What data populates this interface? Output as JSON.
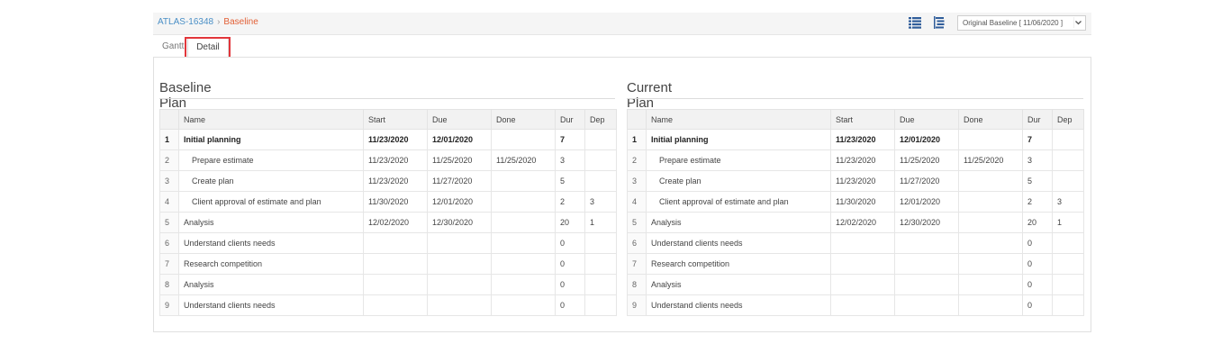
{
  "breadcrumb": {
    "project": "ATLAS-16348",
    "separator": "›",
    "current": "Baseline"
  },
  "baseline_select": {
    "value": "Original Baseline [ 11/06/2020 ]"
  },
  "tabs": [
    {
      "label": "Gantt"
    },
    {
      "label": "Detail",
      "active": true
    }
  ],
  "columns": {
    "name": "Name",
    "start": "Start",
    "due": "Due",
    "done": "Done",
    "dur": "Dur",
    "dep": "Dep"
  },
  "baseline": {
    "title": "Baseline Plan",
    "rows": [
      {
        "num": "1",
        "name": "Initial planning",
        "start": "11/23/2020",
        "due": "12/01/2020",
        "done": "",
        "dur": "7",
        "dep": "",
        "bold": true,
        "indent": 0
      },
      {
        "num": "2",
        "name": "Prepare estimate",
        "start": "11/23/2020",
        "due": "11/25/2020",
        "done": "11/25/2020",
        "dur": "3",
        "dep": "",
        "indent": 1
      },
      {
        "num": "3",
        "name": "Create plan",
        "start": "11/23/2020",
        "due": "11/27/2020",
        "done": "",
        "dur": "5",
        "dep": "",
        "indent": 1
      },
      {
        "num": "4",
        "name": "Client approval of estimate and plan",
        "start": "11/30/2020",
        "due": "12/01/2020",
        "done": "",
        "dur": "2",
        "dep": "3",
        "indent": 1
      },
      {
        "num": "5",
        "name": "Analysis",
        "start": "12/02/2020",
        "due": "12/30/2020",
        "done": "",
        "dur": "20",
        "dep": "1",
        "indent": 0
      },
      {
        "num": "6",
        "name": "Understand clients needs",
        "start": "",
        "due": "",
        "done": "",
        "dur": "0",
        "dep": "",
        "indent": 0
      },
      {
        "num": "7",
        "name": "Research competition",
        "start": "",
        "due": "",
        "done": "",
        "dur": "0",
        "dep": "",
        "indent": 0
      },
      {
        "num": "8",
        "name": "Analysis",
        "start": "",
        "due": "",
        "done": "",
        "dur": "0",
        "dep": "",
        "indent": 0
      },
      {
        "num": "9",
        "name": "Understand clients needs",
        "start": "",
        "due": "",
        "done": "",
        "dur": "0",
        "dep": "",
        "indent": 0
      }
    ]
  },
  "current": {
    "title": "Current Plan",
    "rows": [
      {
        "num": "1",
        "name": "Initial planning",
        "start": "11/23/2020",
        "due": "12/01/2020",
        "done": "",
        "dur": "7",
        "dep": "",
        "bold": true,
        "indent": 0
      },
      {
        "num": "2",
        "name": "Prepare estimate",
        "start": "11/23/2020",
        "due": "11/25/2020",
        "done": "11/25/2020",
        "dur": "3",
        "dep": "",
        "indent": 1
      },
      {
        "num": "3",
        "name": "Create plan",
        "start": "11/23/2020",
        "due": "11/27/2020",
        "done": "",
        "dur": "5",
        "dep": "",
        "indent": 1
      },
      {
        "num": "4",
        "name": "Client approval of estimate and plan",
        "start": "11/30/2020",
        "due": "12/01/2020",
        "done": "",
        "dur": "2",
        "dep": "3",
        "indent": 1
      },
      {
        "num": "5",
        "name": "Analysis",
        "start": "12/02/2020",
        "due": "12/30/2020",
        "done": "",
        "dur": "20",
        "dep": "1",
        "indent": 0
      },
      {
        "num": "6",
        "name": "Understand clients needs",
        "start": "",
        "due": "",
        "done": "",
        "dur": "0",
        "dep": "",
        "indent": 0
      },
      {
        "num": "7",
        "name": "Research competition",
        "start": "",
        "due": "",
        "done": "",
        "dur": "0",
        "dep": "",
        "indent": 0
      },
      {
        "num": "8",
        "name": "Analysis",
        "start": "",
        "due": "",
        "done": "",
        "dur": "0",
        "dep": "",
        "indent": 0
      },
      {
        "num": "9",
        "name": "Understand clients needs",
        "start": "",
        "due": "",
        "done": "",
        "dur": "0",
        "dep": "",
        "indent": 0
      }
    ]
  },
  "icons": {
    "list_view": "list-view-icon",
    "tree_view": "tree-view-icon",
    "dropdown": "chevron-down-icon"
  },
  "colors": {
    "link": "#4a8fc6",
    "current_crumb": "#e25f35",
    "highlight": "#e2363b",
    "icon_blue": "#2f5d9a"
  }
}
